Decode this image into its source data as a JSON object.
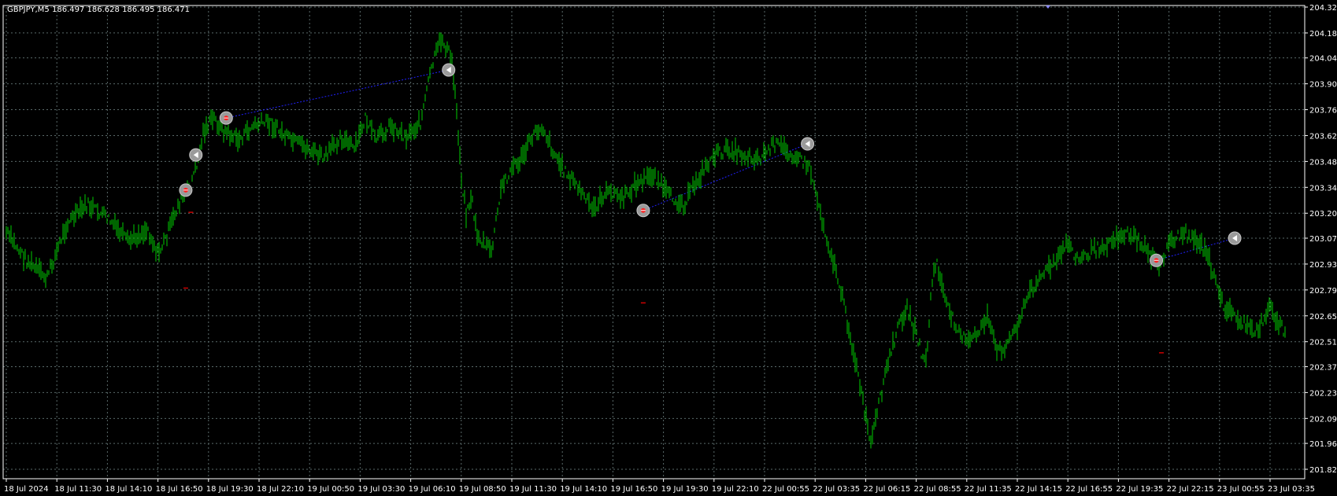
{
  "header": {
    "symbol": "GBPJPY,M5",
    "ohlc": "186.497 186.628 186.495 186.471"
  },
  "colors": {
    "background": "#000000",
    "grid": "#5a6a6a",
    "axis": "#ffffff",
    "bars": "#00cc00",
    "trade_line": "#2020ff",
    "marker_fill": "#9a9a9a",
    "marker_buy": "#ff2020",
    "marker_close": "#ffffff",
    "stop_level": "#cc0000",
    "top_marker": "#8888ff"
  },
  "chart_data": {
    "type": "line",
    "title": "GBPJPY,M5",
    "grid": true,
    "y_ticks": [
      "204.320",
      "204.180",
      "204.045",
      "203.905",
      "203.765",
      "203.625",
      "203.485",
      "203.345",
      "203.205",
      "203.070",
      "202.930",
      "202.790",
      "202.650",
      "202.510",
      "202.375",
      "202.235",
      "202.095",
      "201.960",
      "201.820"
    ],
    "ylim": [
      201.82,
      204.32
    ],
    "x_ticks": [
      "18 Jul 2024",
      "18 Jul 11:30",
      "18 Jul 14:10",
      "18 Jul 16:50",
      "18 Jul 19:30",
      "18 Jul 22:10",
      "19 Jul 00:50",
      "19 Jul 03:30",
      "19 Jul 06:10",
      "19 Jul 08:50",
      "19 Jul 11:30",
      "19 Jul 14:10",
      "19 Jul 16:50",
      "19 Jul 19:30",
      "19 Jul 22:10",
      "22 Jul 00:55",
      "22 Jul 03:35",
      "22 Jul 06:15",
      "22 Jul 08:55",
      "22 Jul 11:35",
      "22 Jul 14:15",
      "22 Jul 16:55",
      "22 Jul 19:35",
      "22 Jul 22:15",
      "23 Jul 00:55",
      "23 Jul 03:35"
    ],
    "series": [
      {
        "name": "GBPJPY,M5",
        "x_index": [
          0,
          0.4,
          0.8,
          1.2,
          1.6,
          2.0,
          2.4,
          2.8,
          3.0,
          3.2,
          3.4,
          3.6,
          3.8,
          3.9,
          4.1,
          4.3,
          4.6,
          4.9,
          5.2,
          5.6,
          6.0,
          6.3,
          6.6,
          6.9,
          7.1,
          7.3,
          7.6,
          7.9,
          8.2,
          8.4,
          8.6,
          8.8,
          8.9,
          9.0,
          9.1,
          9.2,
          9.3,
          9.4,
          9.6,
          9.8,
          10.0,
          10.2,
          10.4,
          10.6,
          10.8,
          11.0,
          11.3,
          11.6,
          11.8,
          12.0,
          12.2,
          12.4,
          12.6,
          12.8,
          13.1,
          13.4,
          13.7,
          14.0,
          14.3,
          14.6,
          14.9,
          15.2,
          15.4,
          15.6,
          15.9,
          16.2,
          16.5,
          16.8,
          17.1,
          17.4,
          17.6,
          17.8,
          18.0,
          18.1,
          18.2,
          18.3,
          18.4,
          18.6,
          18.8,
          19.0,
          19.2,
          19.4,
          19.6,
          19.8,
          20.0,
          20.2,
          20.4,
          20.6,
          20.8,
          21.0,
          21.2,
          21.5,
          21.8,
          22.0,
          22.2,
          22.4,
          22.6,
          22.8,
          23.0,
          23.3,
          23.6,
          23.8,
          24.0,
          24.1,
          24.3,
          24.5,
          24.7,
          25.0,
          25.3
        ],
        "values": [
          203.1,
          202.95,
          202.85,
          203.15,
          203.25,
          203.18,
          203.05,
          203.12,
          202.98,
          203.1,
          203.25,
          203.32,
          203.5,
          203.65,
          203.72,
          203.65,
          203.6,
          203.68,
          203.7,
          203.6,
          203.55,
          203.5,
          203.62,
          203.55,
          203.72,
          203.6,
          203.68,
          203.62,
          203.7,
          203.98,
          204.15,
          204.05,
          203.8,
          203.4,
          203.2,
          203.3,
          203.1,
          203.05,
          203.0,
          203.35,
          203.45,
          203.5,
          203.62,
          203.68,
          203.55,
          203.45,
          203.35,
          203.22,
          203.3,
          203.32,
          203.28,
          203.35,
          203.38,
          203.42,
          203.3,
          203.25,
          203.4,
          203.52,
          203.55,
          203.52,
          203.5,
          203.58,
          203.55,
          203.52,
          203.45,
          203.1,
          202.8,
          202.4,
          201.95,
          202.35,
          202.55,
          202.7,
          202.55,
          202.45,
          202.4,
          202.8,
          202.95,
          202.7,
          202.6,
          202.5,
          202.55,
          202.65,
          202.45,
          202.5,
          202.6,
          202.75,
          202.85,
          202.9,
          202.95,
          203.05,
          202.95,
          203.0,
          203.05,
          203.08,
          203.1,
          203.05,
          203.0,
          202.9,
          203.05,
          203.1,
          203.05,
          202.95,
          202.75,
          202.7,
          202.65,
          202.6,
          202.55,
          202.7,
          202.55
        ]
      }
    ],
    "trades": [
      {
        "kind": "buy",
        "x_index": 3.55,
        "y": 203.33
      },
      {
        "kind": "close",
        "x_index": 3.75,
        "y": 203.52
      },
      {
        "kind": "buy",
        "x_index": 4.35,
        "y": 203.72
      },
      {
        "kind": "close",
        "x_index": 8.75,
        "y": 203.98
      },
      {
        "kind": "buy",
        "x_index": 12.6,
        "y": 203.22
      },
      {
        "kind": "close",
        "x_index": 15.85,
        "y": 203.58
      },
      {
        "kind": "buy",
        "x_index": 22.75,
        "y": 202.95
      },
      {
        "kind": "close",
        "x_index": 24.3,
        "y": 203.07
      }
    ],
    "trade_lines": [
      {
        "from": 2,
        "to": 3
      },
      {
        "from": 4,
        "to": 5
      },
      {
        "from": 6,
        "to": 7
      }
    ],
    "stop_levels": [
      {
        "x_index": 3.65,
        "y": 203.21
      },
      {
        "x_index": 3.55,
        "y": 202.8
      },
      {
        "x_index": 12.6,
        "y": 202.72
      },
      {
        "x_index": 22.85,
        "y": 202.45
      }
    ]
  }
}
